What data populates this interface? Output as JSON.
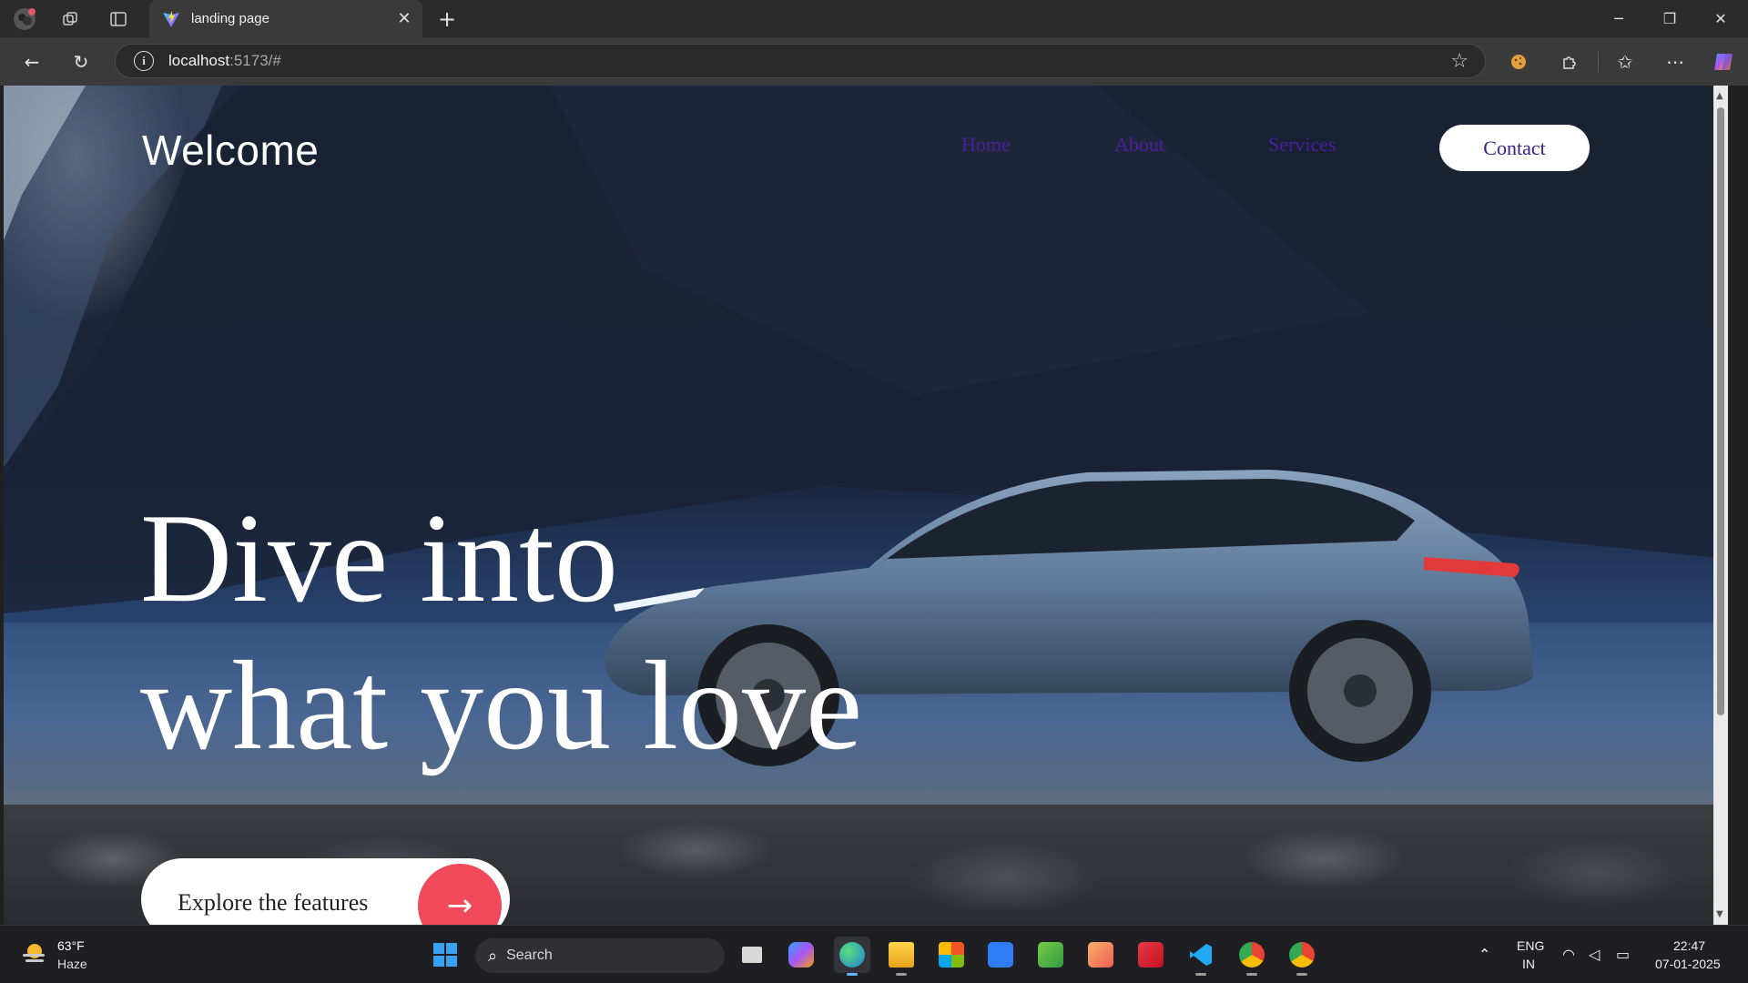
{
  "browser": {
    "tab_title": "landing page",
    "url_host": "localhost",
    "url_rest": ":5173/#",
    "icons": [
      "profile-avatar-icon",
      "workspaces-icon",
      "vertical-tabs-icon",
      "vite-favicon",
      "close-icon",
      "new-tab-icon",
      "minimize-icon",
      "restore-icon",
      "window-close-icon",
      "back-icon",
      "refresh-icon",
      "site-info-icon",
      "favorite-star-icon",
      "cookie-extension-icon",
      "extensions-icon",
      "favorites-icon",
      "more-icon",
      "copilot-icon"
    ]
  },
  "page": {
    "logo": "Welcome",
    "nav": [
      "Home",
      "About",
      "Services"
    ],
    "contact": "Contact",
    "hero_line1": "Dive into",
    "hero_line2": "what you love",
    "cta": "Explore the features",
    "cta_icon": "arrow-right-icon"
  },
  "taskbar": {
    "weather_temp": "63°F",
    "weather_desc": "Haze",
    "search_label": "Search",
    "lang": "ENG",
    "region": "IN",
    "time": "22:47",
    "date": "07-01-2025",
    "apps": [
      "windows-start-icon",
      "task-view-icon",
      "copilot-app-icon",
      "edge-icon",
      "file-explorer-icon",
      "microsoft-store-icon",
      "docs-icon",
      "app-green-icon",
      "app-orange-icon",
      "app-red-icon",
      "vscode-icon",
      "chrome-profile-md-icon",
      "chrome-profile-md2-icon"
    ]
  },
  "colors": {
    "nav_link": "#4b1e9e",
    "cta_arrow_bg": "#f0495a",
    "taskbar_bg": "#1f1f23"
  }
}
